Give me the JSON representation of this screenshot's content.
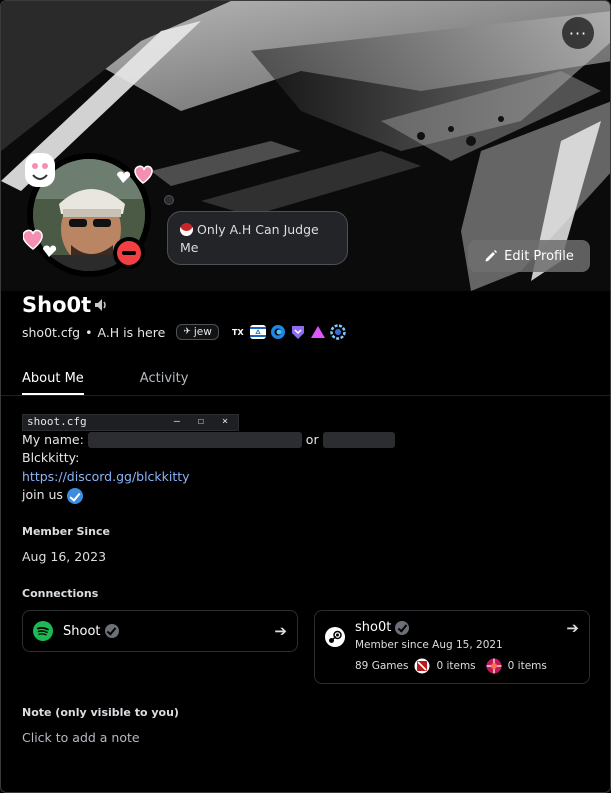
{
  "profile": {
    "display_name": "Sho0t",
    "username": "sho0t.cfg",
    "pronoun_separator": "•",
    "tagline": "A.H is here",
    "tag_pill": "jew",
    "custom_status": "Only A.H Can Judge Me",
    "status": "do-not-disturb",
    "edit_button": "Edit Profile",
    "more_button": "···"
  },
  "badges": [
    "tx-badge",
    "israel-flag-badge",
    "hypesquad-balance-badge",
    "nitro-badge",
    "triangle-badge",
    "quest-badge"
  ],
  "tabs": [
    {
      "label": "About Me",
      "active": true
    },
    {
      "label": "Activity",
      "active": false
    }
  ],
  "about": {
    "code_title": "shoot.cfg",
    "code_controls": "— ☐ ×",
    "line_name_label": "My name:",
    "line_name_or": "or",
    "line_blckkitty": "Blckkitty:",
    "link": "https://discord.gg/blckkitty",
    "join_text": "join us"
  },
  "member_since": {
    "title": "Member Since",
    "value": "Aug 16, 2023"
  },
  "connections": {
    "title": "Connections",
    "spotify": {
      "name": "Shoot"
    },
    "steam": {
      "name": "sho0t",
      "member_since": "Member since Aug 15, 2021",
      "games": "89 Games",
      "dota_items": "0 items",
      "tf_items": "0 items"
    }
  },
  "note": {
    "title": "Note (only visible to you)",
    "placeholder": "Click to add a note"
  },
  "colors": {
    "dnd_red": "#f23f43",
    "link_blue": "#8ab4f8",
    "verified_blue": "#3b8de0",
    "spotify_green": "#1db954"
  }
}
